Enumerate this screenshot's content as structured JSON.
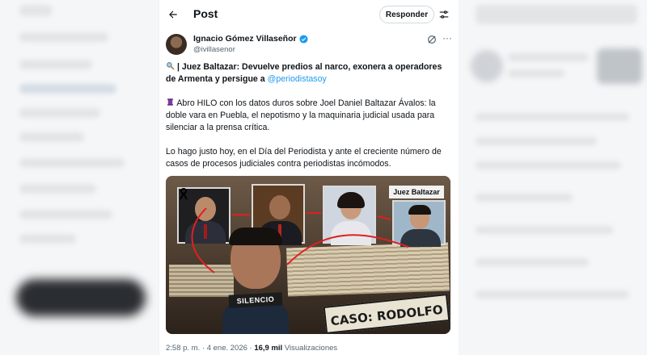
{
  "header": {
    "title": "Post",
    "reply_label": "Responder"
  },
  "author": {
    "name": "Ignacio Gómez Villaseñor",
    "handle": "@ivillasenor"
  },
  "tweet": {
    "line1_bold": "| Juez Baltazar: Devuelve predios al narco, exonera a operadores de Armenta y persigue a ",
    "line1_mention": "@periodistasoy",
    "paragraph2": "Abro HILO con los datos duros sobre Joel Daniel Baltazar Ávalos: la doble vara en Puebla, el nepotismo y la maquinaria judicial usada para silenciar a la prensa crítica.",
    "paragraph3": "Lo hago justo hoy, en el Día del Periodista y ante el creciente número de casos de procesos judiciales contra periodistas incómodos."
  },
  "media": {
    "label_juez": "Juez Baltazar",
    "label_silencio": "SILENCIO",
    "label_caso": "CASO: RODOLFO RUIZ"
  },
  "meta": {
    "time": "2:58 p. m.",
    "separator": "·",
    "date": "4 ene. 2026",
    "views_count": "16,9 mil",
    "views_label": "Visualizaciones"
  },
  "colors": {
    "accent": "#1d9bf0",
    "text": "#0f1419",
    "muted": "#536471"
  }
}
